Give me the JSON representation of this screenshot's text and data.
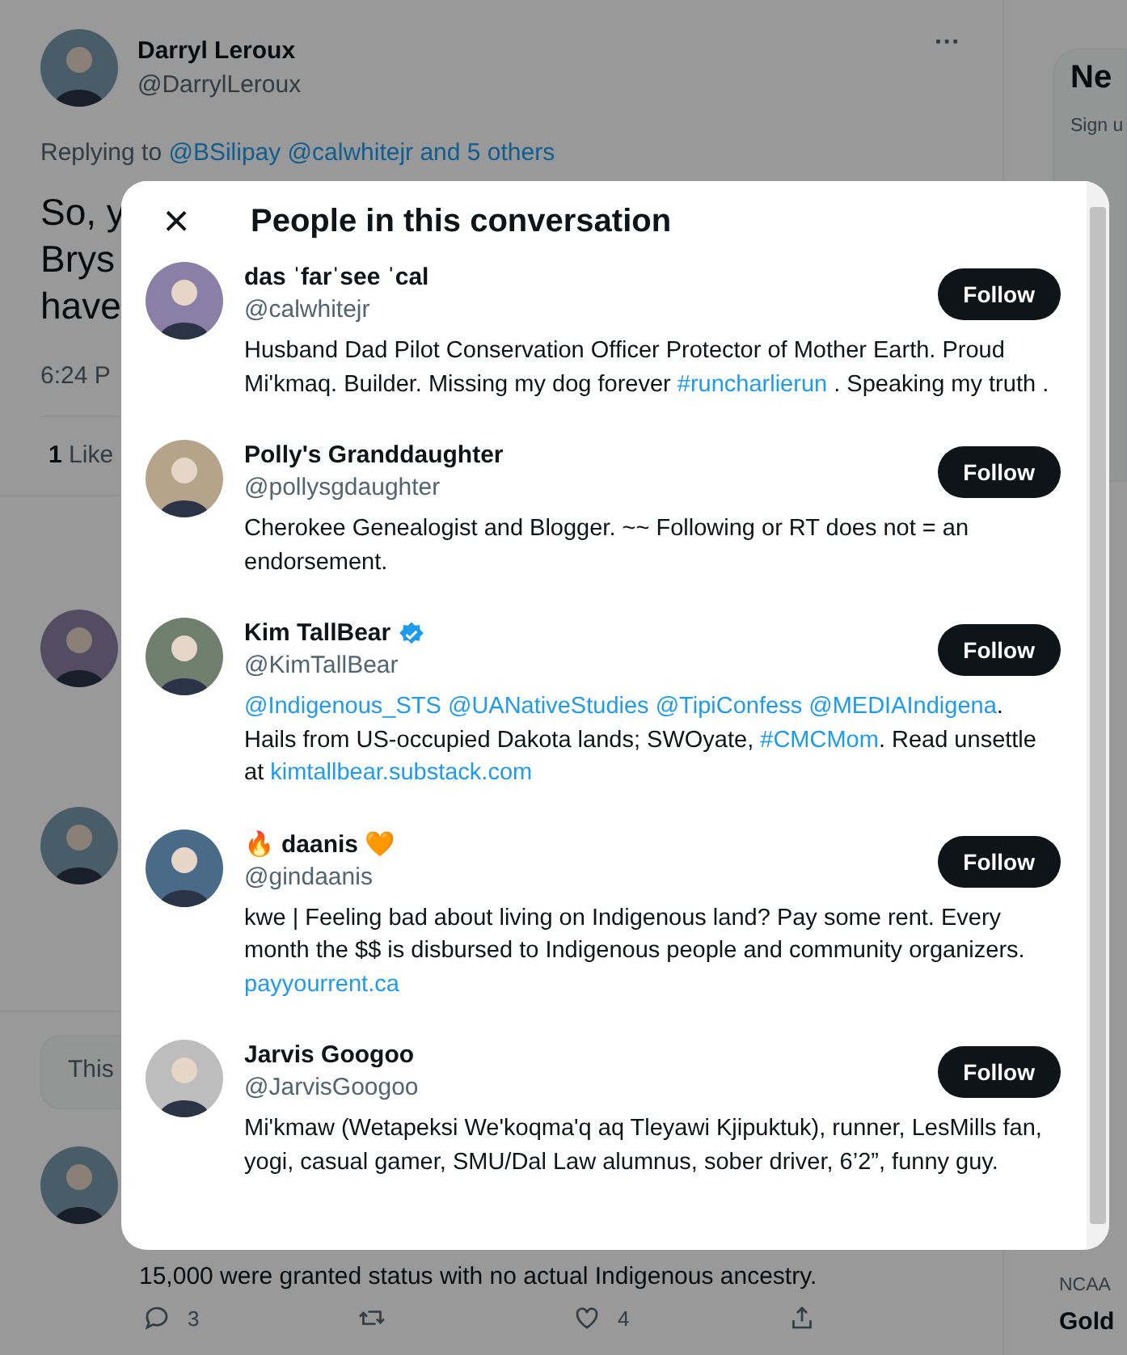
{
  "tweet": {
    "name": "Darryl Leroux",
    "handle": "@DarrylLeroux",
    "more": "···",
    "replying_label": "Replying to",
    "replying_to": "@BSilipay @calwhitejr and 5 others",
    "text_lines": [
      "So, y",
      "Brys",
      "have"
    ],
    "time": "6:24 P",
    "likes_count": "1",
    "likes_label": "Like"
  },
  "note_card": {
    "text": "This"
  },
  "reply": {
    "text": "15,000 were granted status with no actual Indigenous ancestry.",
    "actions": [
      {
        "kind": "reply",
        "count": "3"
      },
      {
        "kind": "retweet"
      },
      {
        "kind": "like",
        "count": "4"
      },
      {
        "kind": "share"
      }
    ]
  },
  "sidebar": {
    "card_title": "Ne",
    "card_text": "Sign u",
    "trend_category": "NCAA",
    "trend_title": "Gold"
  },
  "modal": {
    "title": "People in this conversation",
    "close": "×",
    "people": [
      {
        "name": "das ˈfarˈsee ˈcal",
        "verified": false,
        "handle": "@calwhitejr",
        "follow": "Follow",
        "bio": [
          {
            "kind": "text",
            "text": "Husband Dad Pilot Conservation Officer Protector of Mother Earth. Proud Mi'kmaq. Builder. Missing my dog forever "
          },
          {
            "kind": "link",
            "text": "#runcharlierun"
          },
          {
            "kind": "text",
            "text": " . Speaking my truth ."
          }
        ]
      },
      {
        "name": "Polly's Granddaughter",
        "verified": false,
        "handle": "@pollysgdaughter",
        "follow": "Follow",
        "bio": [
          {
            "kind": "text",
            "text": "Cherokee Genealogist and Blogger. ~~ Following or RT does not = an endorsement."
          }
        ]
      },
      {
        "name": "Kim TallBear",
        "verified": true,
        "handle": "@KimTallBear",
        "follow": "Follow",
        "bio": [
          {
            "kind": "link",
            "text": "@Indigenous_STS"
          },
          {
            "kind": "link",
            "text": "@UANativeStudies"
          },
          {
            "kind": "link",
            "text": "@TipiConfess"
          },
          {
            "kind": "link",
            "text": "@MEDIAIndigena"
          },
          {
            "kind": "text",
            "text": ". Hails from US-occupied Dakota lands; SWOyate, "
          },
          {
            "kind": "link",
            "text": "#CMCMom"
          },
          {
            "kind": "text",
            "text": ". Read unsettle at "
          },
          {
            "kind": "link",
            "text": "kimtallbear.substack.com"
          }
        ]
      },
      {
        "name": "daanis",
        "name_prefix": "🔥",
        "name_suffix": "🧡",
        "verified": false,
        "handle": "@gindaanis",
        "follow": "Follow",
        "bio": [
          {
            "kind": "text",
            "text": "kwe | Feeling bad about living on Indigenous land? Pay some rent. Every month the $$ is disbursed to Indigenous people and community organizers. "
          },
          {
            "kind": "link",
            "text": "payyourrent.ca"
          }
        ]
      },
      {
        "name": "Jarvis Googoo",
        "verified": false,
        "handle": "@JarvisGoogoo",
        "follow": "Follow",
        "bio": [
          {
            "kind": "text",
            "text": "Mi'kmaw (Wetapeksi We'koqma'q aq Tleyawi Kjipuktuk), runner, LesMills fan, yogi, casual gamer, SMU/Dal Law alumnus, sober driver, 6’2”, funny guy."
          }
        ]
      }
    ]
  }
}
